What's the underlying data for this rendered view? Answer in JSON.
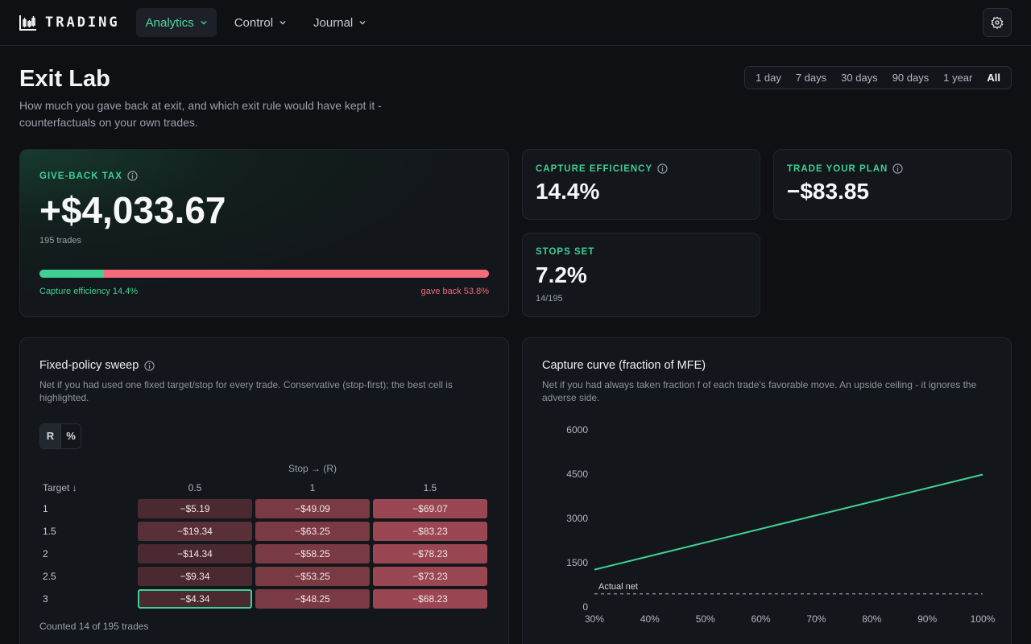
{
  "nav": {
    "brand": "TRADING",
    "items": [
      {
        "label": "Analytics",
        "active": true
      },
      {
        "label": "Control",
        "active": false
      },
      {
        "label": "Journal",
        "active": false
      }
    ],
    "settings_icon": "gear-icon"
  },
  "header": {
    "title": "Exit Lab",
    "subtitle": "How much you gave back at exit, and which exit rule would have kept it - counterfactuals on your own trades.",
    "ranges": [
      "1 day",
      "7 days",
      "30 days",
      "90 days",
      "1 year",
      "All"
    ],
    "active_range": "All"
  },
  "hero": {
    "label": "GIVE-BACK TAX",
    "value": "+$4,033.67",
    "sub": "195 trades",
    "capture_fraction": 0.144,
    "bar_left_label": "Capture efficiency 14.4%",
    "bar_right_label": "gave back 53.8%",
    "colors": {
      "capture": "#3fd194",
      "giveback": "#f46c7c"
    }
  },
  "stats": {
    "capture": {
      "label": "CAPTURE EFFICIENCY",
      "value": "14.4%"
    },
    "plan": {
      "label": "TRADE YOUR PLAN",
      "value": "−$83.85"
    },
    "stops": {
      "label": "STOPS SET",
      "value": "7.2%",
      "sub": "14/195"
    }
  },
  "sweep": {
    "title": "Fixed-policy sweep",
    "description": "Net if you had used one fixed target/stop for every trade. Conservative (stop-first); the best cell is highlighted.",
    "toggle": [
      "R",
      "%"
    ],
    "toggle_active": "R",
    "stop_header": "Stop → (R)",
    "target_header": "Target ↓",
    "stops": [
      "0.5",
      "1",
      "1.5"
    ],
    "rows": [
      {
        "target": "1",
        "cells": [
          "−$5.19",
          "−$49.09",
          "−$69.07"
        ]
      },
      {
        "target": "1.5",
        "cells": [
          "−$19.34",
          "−$63.25",
          "−$83.23"
        ]
      },
      {
        "target": "2",
        "cells": [
          "−$14.34",
          "−$58.25",
          "−$78.23"
        ]
      },
      {
        "target": "2.5",
        "cells": [
          "−$9.34",
          "−$53.25",
          "−$73.23"
        ]
      },
      {
        "target": "3",
        "cells": [
          "−$4.34",
          "−$48.25",
          "−$68.23"
        ]
      }
    ],
    "cell_colors": [
      "#4a2a30",
      "#7a3a44",
      "#9a4653"
    ],
    "best": {
      "row": 4,
      "col": 0,
      "color": "#3fd194"
    },
    "footer": "Counted 14 of 195 trades"
  },
  "curve": {
    "title": "Capture curve (fraction of MFE)",
    "description": "Net if you had always taken fraction f of each trade's favorable move. An upside ceiling - it ignores the adverse side.",
    "chart_data": {
      "type": "line",
      "x": [
        "30%",
        "40%",
        "50%",
        "60%",
        "70%",
        "80%",
        "90%",
        "100%"
      ],
      "x_values": [
        30,
        40,
        50,
        60,
        70,
        80,
        90,
        100
      ],
      "series": [
        {
          "values": [
            1320,
            1780,
            2240,
            2700,
            3160,
            3620,
            4080,
            4540
          ],
          "color": "#3fd194"
        }
      ],
      "reference": {
        "label": "Actual net",
        "value": 500,
        "style": "dashed"
      },
      "yticks": [
        "6000",
        "4500",
        "3000",
        "1500",
        "0"
      ],
      "ylim": [
        0,
        6000
      ],
      "xlim": [
        30,
        100
      ]
    }
  }
}
